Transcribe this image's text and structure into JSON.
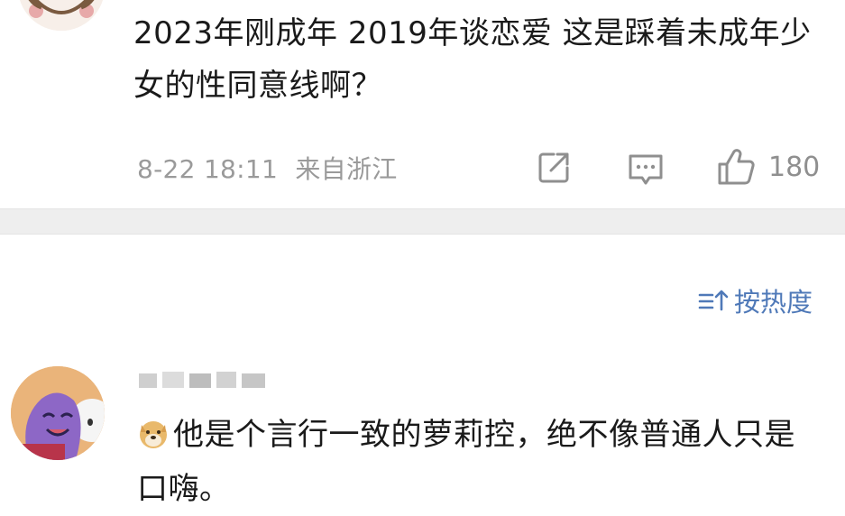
{
  "comment1": {
    "text": "2023年刚成年 2019年谈恋爱 这是踩着未成年少女的性同意线啊？",
    "time": "8-22 18:11",
    "location": "来自浙江",
    "likes": "180"
  },
  "sort": {
    "label": "按热度"
  },
  "comment2": {
    "text": "他是个言行一致的萝莉控，绝不像普通人只是口嗨。"
  },
  "icons": {
    "share": "share-icon",
    "reply": "comment-icon",
    "like": "thumbs-up-icon",
    "sort": "sort-icon",
    "emoji": "doge-emoji-icon"
  },
  "colors": {
    "link_blue": "#4f79b8",
    "meta_gray": "#9a9a9a",
    "divider": "#eeeeee"
  }
}
